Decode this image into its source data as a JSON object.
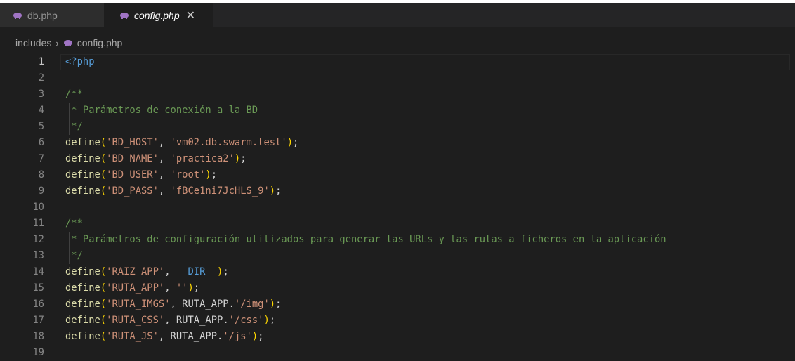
{
  "tabs": [
    {
      "label": "db.php",
      "icon": "php-elephant-icon",
      "active": false
    },
    {
      "label": "config.php",
      "icon": "php-elephant-icon",
      "active": true,
      "close": "✕"
    }
  ],
  "breadcrumb": {
    "folder": "includes",
    "separator": "›",
    "file": "config.php"
  },
  "editor": {
    "lines": [
      {
        "n": "1",
        "tokens": [
          {
            "t": "<?php",
            "c": "tag"
          }
        ]
      },
      {
        "n": "2",
        "tokens": []
      },
      {
        "n": "3",
        "tokens": [
          {
            "t": "/**",
            "c": "comment"
          }
        ]
      },
      {
        "n": "4",
        "tokens": [
          {
            "t": " * Parámetros de conexión a la BD",
            "c": "comment"
          }
        ]
      },
      {
        "n": "5",
        "tokens": [
          {
            "t": " */",
            "c": "comment"
          }
        ]
      },
      {
        "n": "6",
        "tokens": [
          {
            "t": "define",
            "c": "fn"
          },
          {
            "t": "(",
            "c": "brace"
          },
          {
            "t": "'BD_HOST'",
            "c": "str"
          },
          {
            "t": ", ",
            "c": "punc"
          },
          {
            "t": "'vm02.db.swarm.test'",
            "c": "str"
          },
          {
            "t": ")",
            "c": "brace"
          },
          {
            "t": ";",
            "c": "punc"
          }
        ]
      },
      {
        "n": "7",
        "tokens": [
          {
            "t": "define",
            "c": "fn"
          },
          {
            "t": "(",
            "c": "brace"
          },
          {
            "t": "'BD_NAME'",
            "c": "str"
          },
          {
            "t": ", ",
            "c": "punc"
          },
          {
            "t": "'practica2'",
            "c": "str"
          },
          {
            "t": ")",
            "c": "brace"
          },
          {
            "t": ";",
            "c": "punc"
          }
        ]
      },
      {
        "n": "8",
        "tokens": [
          {
            "t": "define",
            "c": "fn"
          },
          {
            "t": "(",
            "c": "brace"
          },
          {
            "t": "'BD_USER'",
            "c": "str"
          },
          {
            "t": ", ",
            "c": "punc"
          },
          {
            "t": "'root'",
            "c": "str"
          },
          {
            "t": ")",
            "c": "brace"
          },
          {
            "t": ";",
            "c": "punc"
          }
        ]
      },
      {
        "n": "9",
        "tokens": [
          {
            "t": "define",
            "c": "fn"
          },
          {
            "t": "(",
            "c": "brace"
          },
          {
            "t": "'BD_PASS'",
            "c": "str"
          },
          {
            "t": ", ",
            "c": "punc"
          },
          {
            "t": "'fBCe1ni7JcHLS_9'",
            "c": "str"
          },
          {
            "t": ")",
            "c": "brace"
          },
          {
            "t": ";",
            "c": "punc"
          }
        ]
      },
      {
        "n": "10",
        "tokens": []
      },
      {
        "n": "11",
        "tokens": [
          {
            "t": "/**",
            "c": "comment"
          }
        ]
      },
      {
        "n": "12",
        "tokens": [
          {
            "t": " * Parámetros de configuración utilizados para generar las URLs y las rutas a ficheros en la aplicación",
            "c": "comment"
          }
        ]
      },
      {
        "n": "13",
        "tokens": [
          {
            "t": " */",
            "c": "comment"
          }
        ]
      },
      {
        "n": "14",
        "tokens": [
          {
            "t": "define",
            "c": "fn"
          },
          {
            "t": "(",
            "c": "brace"
          },
          {
            "t": "'RAIZ_APP'",
            "c": "str"
          },
          {
            "t": ", ",
            "c": "punc"
          },
          {
            "t": "__DIR__",
            "c": "magic"
          },
          {
            "t": ")",
            "c": "brace"
          },
          {
            "t": ";",
            "c": "punc"
          }
        ]
      },
      {
        "n": "15",
        "tokens": [
          {
            "t": "define",
            "c": "fn"
          },
          {
            "t": "(",
            "c": "brace"
          },
          {
            "t": "'RUTA_APP'",
            "c": "str"
          },
          {
            "t": ", ",
            "c": "punc"
          },
          {
            "t": "''",
            "c": "str"
          },
          {
            "t": ")",
            "c": "brace"
          },
          {
            "t": ";",
            "c": "punc"
          }
        ]
      },
      {
        "n": "16",
        "tokens": [
          {
            "t": "define",
            "c": "fn"
          },
          {
            "t": "(",
            "c": "brace"
          },
          {
            "t": "'RUTA_IMGS'",
            "c": "str"
          },
          {
            "t": ", ",
            "c": "punc"
          },
          {
            "t": "RUTA_APP",
            "c": "const"
          },
          {
            "t": ".",
            "c": "punc"
          },
          {
            "t": "'/img'",
            "c": "str"
          },
          {
            "t": ")",
            "c": "brace"
          },
          {
            "t": ";",
            "c": "punc"
          }
        ]
      },
      {
        "n": "17",
        "tokens": [
          {
            "t": "define",
            "c": "fn"
          },
          {
            "t": "(",
            "c": "brace"
          },
          {
            "t": "'RUTA_CSS'",
            "c": "str"
          },
          {
            "t": ", ",
            "c": "punc"
          },
          {
            "t": "RUTA_APP",
            "c": "const"
          },
          {
            "t": ".",
            "c": "punc"
          },
          {
            "t": "'/css'",
            "c": "str"
          },
          {
            "t": ")",
            "c": "brace"
          },
          {
            "t": ";",
            "c": "punc"
          }
        ]
      },
      {
        "n": "18",
        "tokens": [
          {
            "t": "define",
            "c": "fn"
          },
          {
            "t": "(",
            "c": "brace"
          },
          {
            "t": "'RUTA_JS'",
            "c": "str"
          },
          {
            "t": ", ",
            "c": "punc"
          },
          {
            "t": "RUTA_APP",
            "c": "const"
          },
          {
            "t": ".",
            "c": "punc"
          },
          {
            "t": "'/js'",
            "c": "str"
          },
          {
            "t": ")",
            "c": "brace"
          },
          {
            "t": ";",
            "c": "punc"
          }
        ]
      },
      {
        "n": "19",
        "tokens": []
      }
    ],
    "current_line": "1"
  },
  "colors": {
    "background": "#1e1e1e",
    "tab_inactive": "#2d2d2d",
    "tab_active": "#1e1e1e",
    "php_icon": "#a074c4"
  }
}
